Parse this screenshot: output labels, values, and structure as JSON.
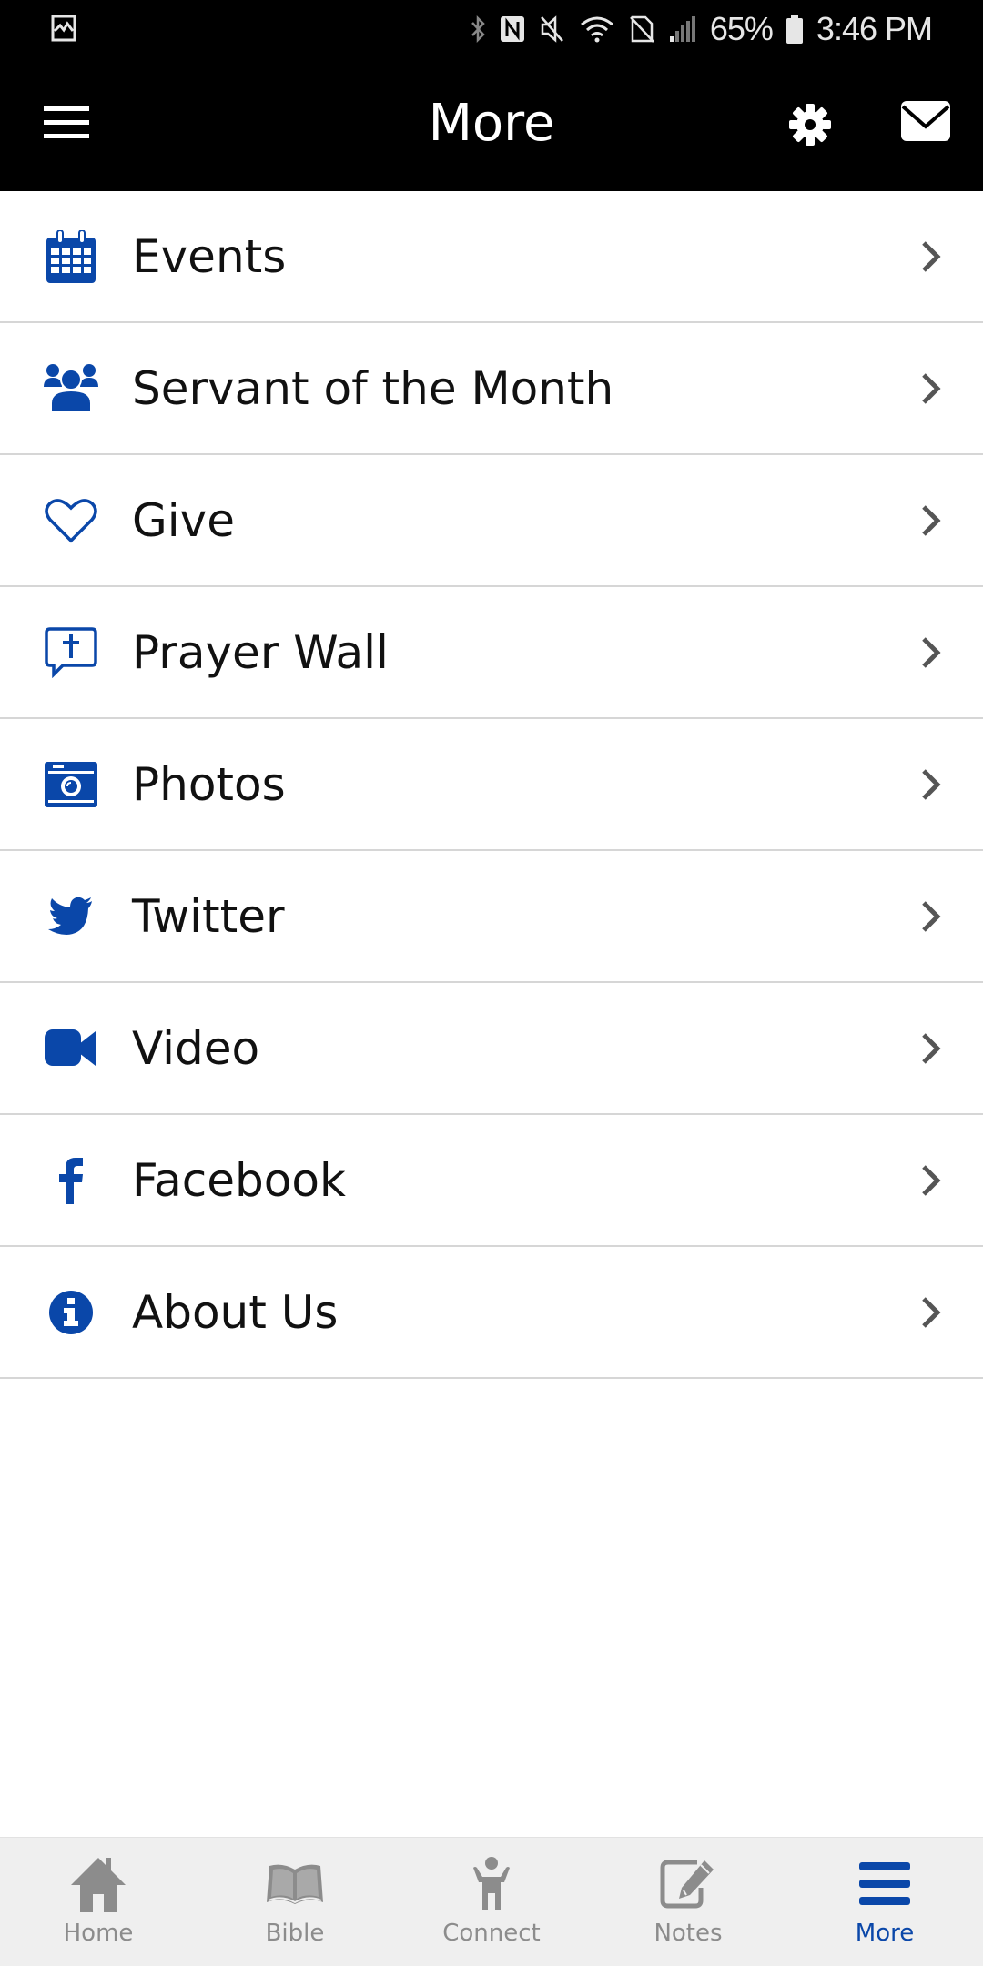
{
  "status_bar": {
    "battery_percent": "65%",
    "time": "3:46 PM",
    "icons": [
      "gallery-notification-icon",
      "bluetooth-icon",
      "nfc-icon",
      "mute-icon",
      "wifi-icon",
      "no-sim-icon",
      "signal-icon",
      "battery-icon"
    ]
  },
  "app_bar": {
    "title": "More",
    "left_icon": "hamburger-menu-icon",
    "right_icons": [
      "settings-gear-icon",
      "mail-icon"
    ]
  },
  "colors": {
    "accent": "#0a47a9",
    "header_bg": "#000000",
    "nav_inactive": "#8c8c8c",
    "divider": "#d6d6d6"
  },
  "menu": {
    "items": [
      {
        "label": "Events",
        "icon": "calendar-icon"
      },
      {
        "label": "Servant of the Month",
        "icon": "group-icon"
      },
      {
        "label": "Give",
        "icon": "heart-icon"
      },
      {
        "label": "Prayer Wall",
        "icon": "prayer-chat-icon"
      },
      {
        "label": "Photos",
        "icon": "camera-icon"
      },
      {
        "label": "Twitter",
        "icon": "twitter-icon"
      },
      {
        "label": "Video",
        "icon": "video-camera-icon"
      },
      {
        "label": "Facebook",
        "icon": "facebook-icon"
      },
      {
        "label": "About Us",
        "icon": "info-icon"
      }
    ]
  },
  "bottom_nav": {
    "active": "More",
    "items": [
      {
        "label": "Home",
        "icon": "home-icon"
      },
      {
        "label": "Bible",
        "icon": "bible-icon"
      },
      {
        "label": "Connect",
        "icon": "connect-person-icon"
      },
      {
        "label": "Notes",
        "icon": "notes-edit-icon"
      },
      {
        "label": "More",
        "icon": "more-menu-icon"
      }
    ]
  }
}
